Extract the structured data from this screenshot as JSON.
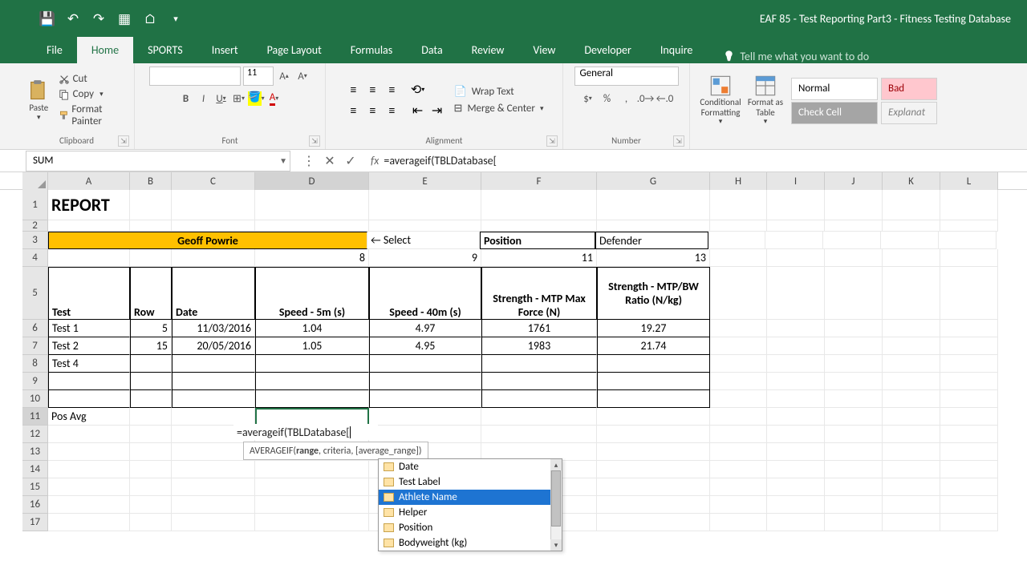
{
  "title": "EAF 85 - Test Reporting Part3 - Fitness Testing Database",
  "tabs": [
    "File",
    "Home",
    "SPORTS",
    "Insert",
    "Page Layout",
    "Formulas",
    "Data",
    "Review",
    "View",
    "Developer",
    "Inquire"
  ],
  "active_tab": "Home",
  "tell_me": "Tell me what you want to do",
  "groups": {
    "clipboard": {
      "label": "Clipboard",
      "paste": "Paste",
      "cut": "Cut",
      "copy": "Copy",
      "fmtpainter": "Format Painter"
    },
    "font": {
      "label": "Font",
      "size": "11"
    },
    "alignment": {
      "label": "Alignment",
      "wrap": "Wrap Text",
      "merge": "Merge & Center"
    },
    "number": {
      "label": "Number",
      "fmt": "General"
    },
    "styles": {
      "cond": "Conditional Formatting",
      "fat": "Format as Table",
      "normal": "Normal",
      "bad": "Bad",
      "check": "Check Cell",
      "explan": "Explanat"
    }
  },
  "name_box": "SUM",
  "formula": "=averageif(TBLDatabase[",
  "columns": [
    "A",
    "B",
    "C",
    "D",
    "E",
    "F",
    "G",
    "H",
    "I",
    "J",
    "K",
    "L"
  ],
  "sheet": {
    "report": "REPORT",
    "select_name": "Geoff Powrie",
    "select_hint": "← Select",
    "position_label": "Position",
    "position_value": "Defender",
    "nums": {
      "D4": "8",
      "E4": "9",
      "F4": "11",
      "G4": "13"
    },
    "headers": {
      "A": "Test",
      "B": "Row",
      "C": "Date",
      "D": "Speed - 5m (s)",
      "E": "Speed - 40m (s)",
      "F": "Strength - MTP Max Force (N)",
      "G": "Strength - MTP/BW Ratio (N/kg)"
    },
    "rows": [
      {
        "test": "Test 1",
        "row": "5",
        "date": "11/03/2016",
        "d": "1.04",
        "e": "4.97",
        "f": "1761",
        "g": "19.27"
      },
      {
        "test": "Test 2",
        "row": "15",
        "date": "20/05/2016",
        "d": "1.05",
        "e": "4.95",
        "f": "1983",
        "g": "21.74"
      },
      {
        "test": "Test 4",
        "row": "",
        "date": "",
        "d": "",
        "e": "",
        "f": "",
        "g": ""
      }
    ],
    "posavg": "Pos Avg",
    "editing_cell": "=averageif(TBLDatabase["
  },
  "tooltip": {
    "fn": "AVERAGEIF(",
    "arg1": "range",
    "rest": ", criteria, [average_range])"
  },
  "autocomplete": {
    "items": [
      "Date",
      "Test Label",
      "Athlete Name",
      "Helper",
      "Position",
      "Bodyweight (kg)"
    ],
    "selected": 2
  },
  "chart_data": {
    "type": "table",
    "title": "REPORT",
    "athlete": "Geoff Powrie",
    "position": "Defender",
    "columns": [
      "Test",
      "Row",
      "Date",
      "Speed - 5m (s)",
      "Speed - 40m (s)",
      "Strength - MTP Max Force (N)",
      "Strength - MTP/BW Ratio (N/kg)"
    ],
    "rows": [
      [
        "Test 1",
        5,
        "11/03/2016",
        1.04,
        4.97,
        1761,
        19.27
      ],
      [
        "Test 2",
        15,
        "20/05/2016",
        1.05,
        4.95,
        1983,
        21.74
      ],
      [
        "Test 4",
        null,
        null,
        null,
        null,
        null,
        null
      ]
    ]
  }
}
